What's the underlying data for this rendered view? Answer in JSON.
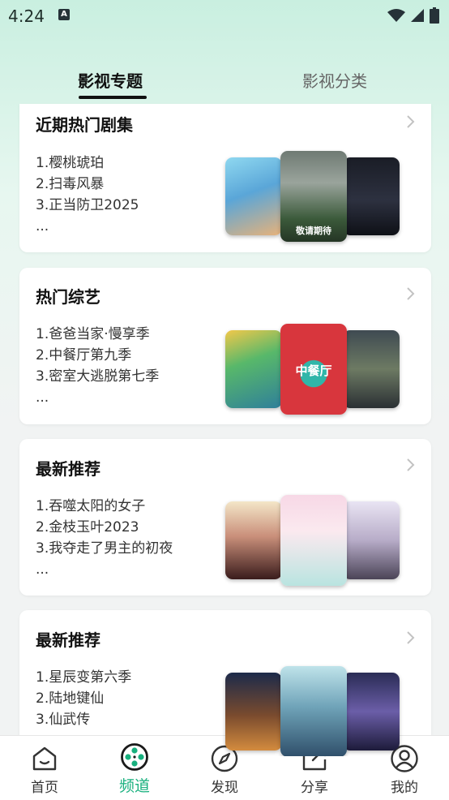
{
  "status_bar": {
    "time": "4:24",
    "notification_glyph": "A"
  },
  "tabs": [
    {
      "label": "影视专题",
      "active": true
    },
    {
      "label": "影视分类",
      "active": false
    }
  ],
  "cards": [
    {
      "title": "近期热门剧集",
      "items": [
        "1.樱桃琥珀",
        "2.扫毒风暴",
        "3.正当防卫2025",
        "..."
      ],
      "poster_texts": [
        "",
        "敬请期待",
        ""
      ]
    },
    {
      "title": "热门综艺",
      "items": [
        "1.爸爸当家·慢享季",
        "2.中餐厅第九季",
        "3.密室大逃脱第七季",
        "..."
      ],
      "poster_texts": [
        "",
        "中餐厅",
        ""
      ]
    },
    {
      "title": "最新推荐",
      "items": [
        "1.吞噬太阳的女子",
        "2.金枝玉叶2023",
        "3.我夺走了男主的初夜",
        "..."
      ],
      "poster_texts": [
        "",
        "",
        ""
      ]
    },
    {
      "title": "最新推荐",
      "items": [
        "1.星辰变第六季",
        "2.陆地键仙",
        "3.仙武传"
      ],
      "poster_texts": [
        "",
        "",
        ""
      ]
    }
  ],
  "bottom_nav": [
    {
      "label": "首页",
      "icon": "home-icon",
      "active": false
    },
    {
      "label": "频道",
      "icon": "film-reel-icon",
      "active": true
    },
    {
      "label": "发现",
      "icon": "compass-icon",
      "active": false
    },
    {
      "label": "分享",
      "icon": "share-icon",
      "active": false
    },
    {
      "label": "我的",
      "icon": "profile-icon",
      "active": false
    }
  ],
  "colors": {
    "accent": "#18b07e",
    "background_top": "#c9efe0",
    "card_background": "#ffffff"
  }
}
